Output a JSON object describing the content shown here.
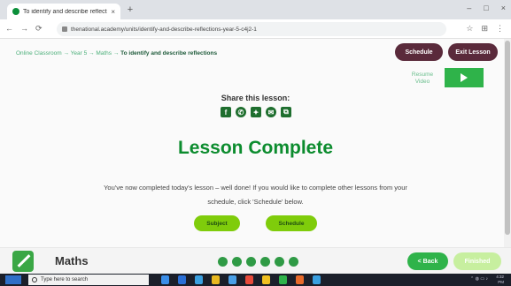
{
  "browser": {
    "tab_title": "To identify and describe reflections",
    "tab_close": "×",
    "new_tab": "+",
    "window_controls": [
      "–",
      "□",
      "×"
    ],
    "nav": [
      "←",
      "→",
      "⟳"
    ],
    "url": "thenational.academy/units/identify-and-describe-reflections-year-5-c4j2-1",
    "extension_icons": [
      "☆",
      "⊞",
      "⋮"
    ]
  },
  "page": {
    "breadcrumb": {
      "path": "Online Classroom → Year 5 → Maths → ",
      "current": "To identify and describe reflections"
    },
    "buttons": {
      "schedule": "Schedule",
      "exit": "Exit Lesson"
    },
    "resume_video": "Resume Video",
    "share_title": "Share this lesson:",
    "share_icons": [
      {
        "name": "facebook-icon",
        "glyph": "f"
      },
      {
        "name": "whatsapp-icon",
        "glyph": "✆"
      },
      {
        "name": "twitter-icon",
        "glyph": "✦"
      },
      {
        "name": "email-icon",
        "glyph": "✉"
      },
      {
        "name": "copy-link-icon",
        "glyph": "⧉"
      }
    ],
    "heading": "Lesson Complete",
    "message": "You've now completed today's lesson – well done! If you would like to complete other lessons from your schedule, click 'Schedule' below.",
    "subject_button": "Subject",
    "schedule_button": "Schedule"
  },
  "lesson_bar": {
    "subject": "Maths",
    "progress_dots": 6,
    "back": "< Back",
    "finished": "Finished"
  },
  "taskbar": {
    "search_placeholder": "Type here to search",
    "app_colors": [
      "#3b8ee8",
      "#2a6fd6",
      "#3aa0e0",
      "#e8b820",
      "#4aa0e8",
      "#e84a3a",
      "#f0c020",
      "#2fb34a",
      "#e86a2a",
      "#3aa0e0"
    ],
    "clock": "4:32 PM",
    "date": "15/06/2020"
  },
  "colors": {
    "accent_green": "#0c8c2e",
    "button_lime": "#7fcc0b",
    "button_dark": "#5a2a3b"
  }
}
